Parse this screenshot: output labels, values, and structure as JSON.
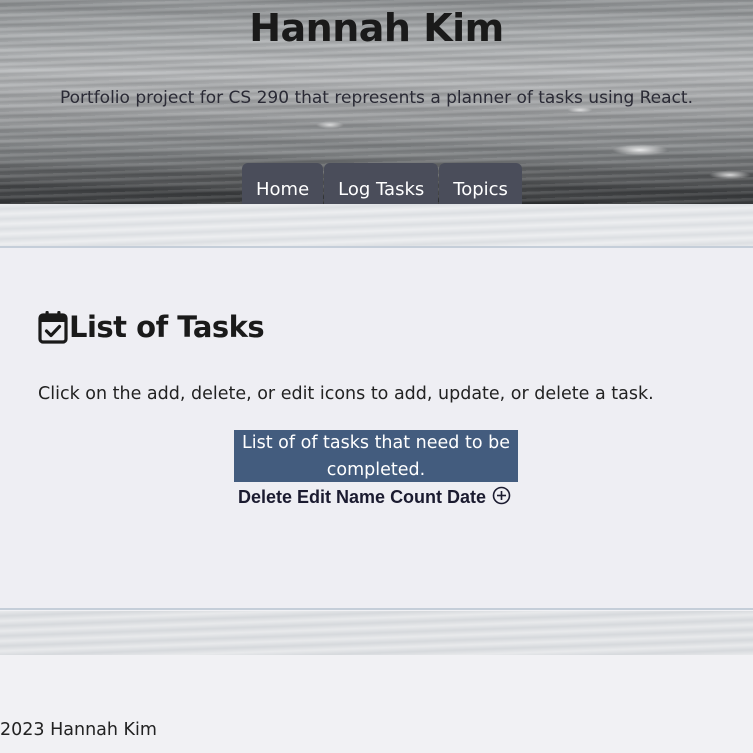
{
  "header": {
    "title": "Hannah Kim",
    "subtitle": "Portfolio project for CS 290 that represents a planner of tasks using React."
  },
  "nav": {
    "items": [
      {
        "label": "Home"
      },
      {
        "label": "Log Tasks"
      },
      {
        "label": "Topics"
      }
    ]
  },
  "main": {
    "title_icon": "calendar-check-icon",
    "title": "List of Tasks",
    "instructions": "Click on the add, delete, or edit icons to add, update, or delete a task.",
    "table": {
      "caption": "List of of tasks that need to be completed.",
      "headers": [
        "Delete",
        "Edit",
        "Name",
        "Count",
        "Date"
      ],
      "add_icon": "plus-circle-icon"
    }
  },
  "footer": {
    "text": "2023 Hannah Kim"
  },
  "colors": {
    "nav_button_bg": "#4a4d5a",
    "caption_bg": "#435c7e",
    "card_bg": "#eeeef3"
  }
}
